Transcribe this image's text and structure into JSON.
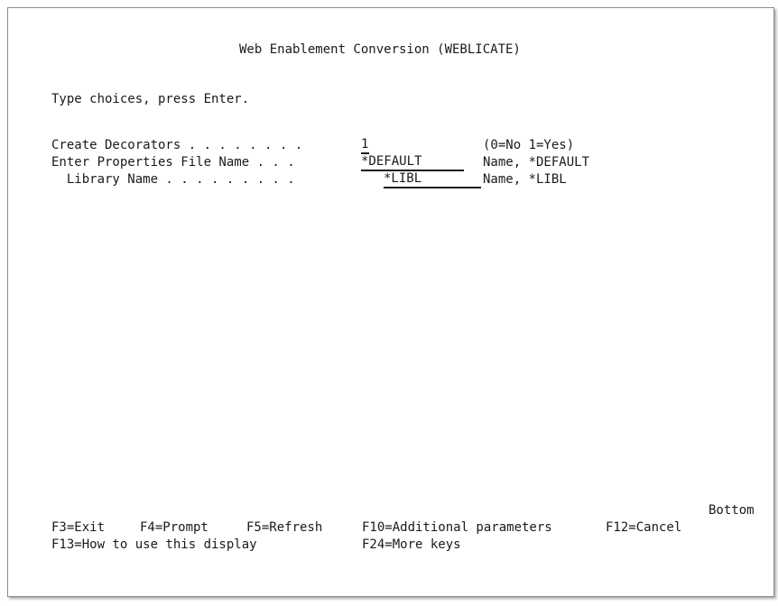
{
  "screen": {
    "title": "Web Enablement Conversion (WEBLICATE)",
    "instruction": "Type choices, press Enter."
  },
  "fields": [
    {
      "label": "Create Decorators . . . . . . . .",
      "value": "1",
      "hint": "(0=No 1=Yes)"
    },
    {
      "label": "Enter Properties File Name . . .",
      "value": "*DEFAULT",
      "hint": "Name, *DEFAULT"
    },
    {
      "label": "  Library Name . . . . . . . . .",
      "value": "*LIBL",
      "hint": "Name, *LIBL"
    }
  ],
  "status": {
    "bottom": "Bottom"
  },
  "function_keys": {
    "f3": "F3=Exit",
    "f4": "F4=Prompt",
    "f5": "F5=Refresh",
    "f10": "F10=Additional parameters",
    "f12": "F12=Cancel",
    "f13": "F13=How to use this display",
    "f24": "F24=More keys"
  }
}
